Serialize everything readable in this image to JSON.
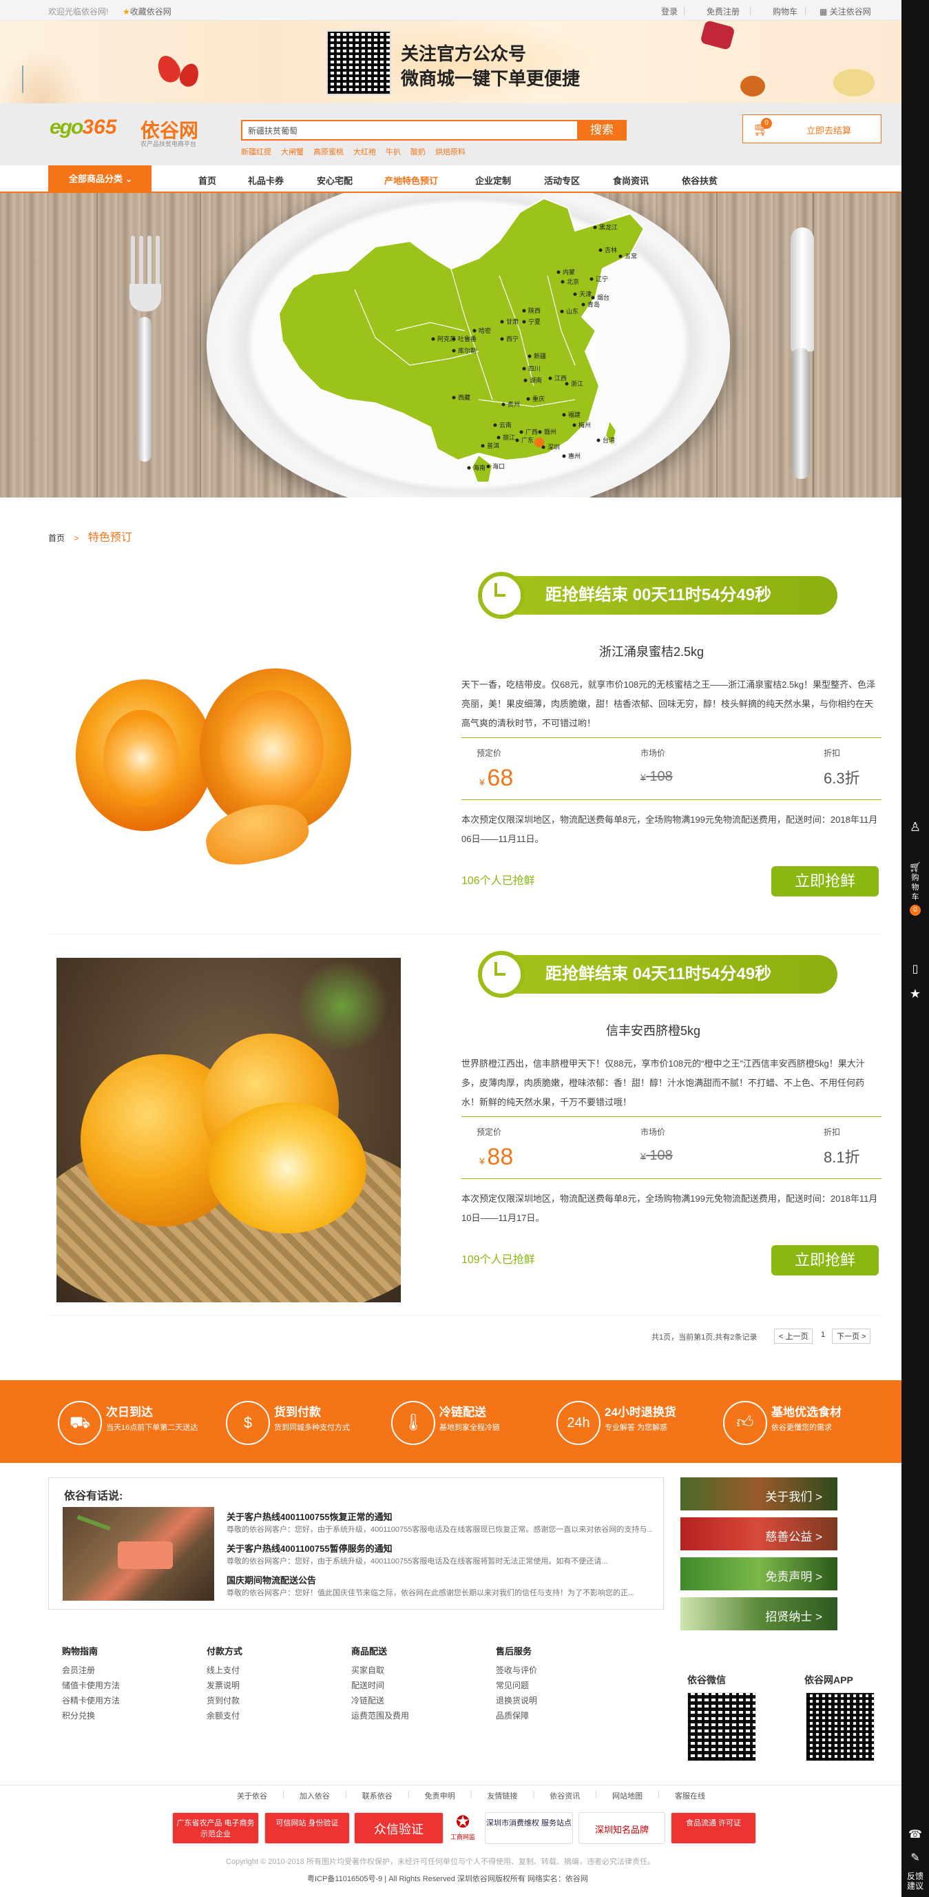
{
  "topbar": {
    "welcome": "欢迎光临依谷网!",
    "favorite": "收藏依谷网",
    "login": "登录",
    "register": "免费注册",
    "cart": "购物车",
    "follow": "关注依谷网"
  },
  "banner": {
    "line1": "关注官方公众号",
    "line2": "微商城一键下单更便捷"
  },
  "logo": {
    "text": "依谷网",
    "slogan": "农产品扶贫电商平台"
  },
  "search": {
    "value": "新疆扶贫葡萄",
    "button": "搜索",
    "hot": [
      "新疆红提",
      "大闸蟹",
      "高原蜜桃",
      "大红袍",
      "牛扒",
      "酸奶",
      "烘焙原料"
    ]
  },
  "cart_btn": {
    "count": "0",
    "label": "立即去结算"
  },
  "nav": {
    "category": "全部商品分类",
    "items": [
      "首页",
      "礼品卡券",
      "安心宅配",
      "产地特色预订",
      "企业定制",
      "活动专区",
      "食尚资讯",
      "依谷扶贫"
    ],
    "active": 3
  },
  "map_labels": [
    "黑龙江",
    "吉林",
    "五常",
    "辽宁",
    "北京",
    "内蒙",
    "烟台",
    "青岛",
    "山东",
    "天津",
    "陕西",
    "宁夏",
    "西宁",
    "甘肃",
    "哈密",
    "吐鲁番",
    "阿克苏",
    "库尔勒",
    "新疆",
    "西藏",
    "丽江",
    "四川",
    "重庆",
    "贵州",
    "云南",
    "广西",
    "广东",
    "海南",
    "湖南",
    "江西",
    "浙江",
    "福建",
    "台湾",
    "梅州",
    "惠州",
    "赣州",
    "深圳",
    "海口",
    "普洱"
  ],
  "breadcrumb": {
    "home": "首页",
    "sep": ">",
    "current": "特色预订"
  },
  "products": [
    {
      "timer": "距抢鲜结束 00天11时54分49秒",
      "name": "浙江涌泉蜜桔2.5kg",
      "desc": "天下一香，吃桔带皮。仅68元，就享市价108元的无核蜜桔之王——浙江涌泉蜜桔2.5kg！果型整齐、色泽亮丽，美！果皮细薄，肉质脆嫩，甜！桔香浓郁、回味无穷，醇！枝头鲜摘的纯天然水果，与你相约在天高气爽的清秋时节，不可错过哟！",
      "pre_label": "预定价",
      "pre_price": "68",
      "mkt_label": "市场价",
      "mkt_price": "108",
      "disc_label": "折扣",
      "discount": "6.3折",
      "currency": "¥",
      "ship": "本次预定仅限深圳地区，物流配送费每单8元，全场购物满199元免物流配送费用，配送时间：2018年11月06日——11月11日。",
      "sold": "106个人已抢鲜",
      "buy": "立即抢鲜"
    },
    {
      "timer": "距抢鲜结束 04天11时54分49秒",
      "name": "信丰安西脐橙5kg",
      "desc": "世界脐橙江西出，信丰脐橙甲天下！仅88元，享市价108元的“橙中之王”江西信丰安西脐橙5kg！果大汁多，皮薄肉厚，肉质脆嫩，橙味浓郁：香！甜！醇！汁水饱满甜而不腻！不打蜡、不上色、不用任何药水！新鲜的纯天然水果，千万不要错过哦！",
      "pre_label": "预定价",
      "pre_price": "88",
      "mkt_label": "市场价",
      "mkt_price": "108",
      "disc_label": "折扣",
      "discount": "8.1折",
      "currency": "¥",
      "ship": "本次预定仅限深圳地区，物流配送费每单8元，全场购物满199元免物流配送费用，配送时间：2018年11月10日——11月17日。",
      "sold": "109个人已抢鲜",
      "buy": "立即抢鲜"
    }
  ],
  "pager": {
    "info": "共1页，当前第1页,共有2条记录",
    "prev": "< 上一页",
    "page": "1",
    "next": "下一页 >"
  },
  "features": [
    {
      "title": "次日到达",
      "sub": "当天16点前下单第二天送达",
      "icon": "truck-icon"
    },
    {
      "title": "货到付款",
      "sub": "货到同城多种支付方式",
      "icon": "cash-icon"
    },
    {
      "title": "冷链配送",
      "sub": "基地到家全程冷链",
      "icon": "thermometer-icon"
    },
    {
      "title": "24小时退换货",
      "sub": "专业解答 为您解惑",
      "icon": "24h-icon"
    },
    {
      "title": "基地优选食材",
      "sub": "依谷更懂您的需求",
      "icon": "thumb-icon"
    }
  ],
  "news": {
    "title": "依谷有话说:",
    "items": [
      {
        "title": "关于客户热线4001100755恢复正常的通知",
        "body": "尊敬的依谷网客户：您好，由于系统升级，4001100755客服电话及在线客服现已恢复正常。感谢您一直以来对依谷网的支持与..."
      },
      {
        "title": "关于客户热线4001100755暂停服务的通知",
        "body": "尊敬的依谷网客户：您好，由于系统升级，4001100755客服电话及在线客服将暂时无法正常使用。如有不便还请..."
      },
      {
        "title": "国庆期间物流配送公告",
        "body": "尊敬的依谷网客户：您好！值此国庆佳节来临之际，依谷网在此感谢您长期以来对我们的信任与支持！为了不影响您的正..."
      }
    ]
  },
  "side_links": [
    "关于我们 >",
    "慈善公益 >",
    "免责声明 >",
    "招贤纳士 >"
  ],
  "footer_cols": [
    {
      "title": "购物指南",
      "items": [
        "会员注册",
        "储值卡使用方法",
        "谷精卡使用方法",
        "积分兑换"
      ]
    },
    {
      "title": "付款方式",
      "items": [
        "线上支付",
        "发票说明",
        "货到付款",
        "余额支付"
      ]
    },
    {
      "title": "商品配送",
      "items": [
        "买家自取",
        "配送时间",
        "冷链配送",
        "运费范围及费用"
      ]
    },
    {
      "title": "售后服务",
      "items": [
        "签收与评价",
        "常见问题",
        "退换货说明",
        "品质保障"
      ]
    }
  ],
  "qr": {
    "wechat": "依谷微信",
    "app": "依谷网APP"
  },
  "footer_links": [
    "关于依谷",
    "加入依谷",
    "联系依谷",
    "免责申明",
    "友情链接",
    "依谷资讯",
    "网站地图",
    "客服在线"
  ],
  "badges": [
    "广东省农产品 电子商务示范企业",
    "可信网站 身份验证",
    "众信验证",
    "工商网监",
    "深圳市消费维权 服务站点",
    "深圳知名品牌",
    "食品流通 许可证"
  ],
  "copyright": "Copyright © 2010-2018 所有图片均受著作权保护，未经许可任何单位与个人不得使用、复制、转载、摘编，违者必究法律责任。",
  "icp": "粤ICP备11016505号-9 | All Rights Reserved 深圳依谷网版权所有 网络实名：依谷网",
  "sidebar": {
    "cart": "购物车",
    "cart_count": "0",
    "feedback": "反馈建议"
  },
  "colors": {
    "orange": "#f67418",
    "green": "#8ab811",
    "accent": "#ff6a00"
  }
}
